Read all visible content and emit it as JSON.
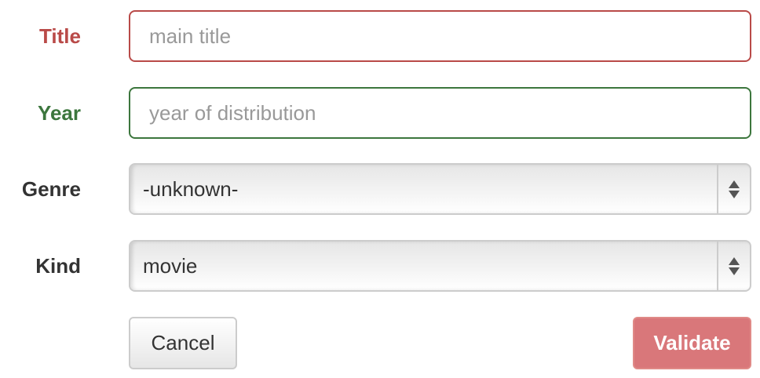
{
  "form": {
    "title": {
      "label": "Title",
      "placeholder": "main title",
      "value": ""
    },
    "year": {
      "label": "Year",
      "placeholder": "year of distribution",
      "value": ""
    },
    "genre": {
      "label": "Genre",
      "selected": "-unknown-"
    },
    "kind": {
      "label": "Kind",
      "selected": "movie"
    }
  },
  "buttons": {
    "cancel": "Cancel",
    "validate": "Validate"
  },
  "colors": {
    "error": "#b94a48",
    "success": "#3c763d",
    "validate_bg": "#d9777a"
  },
  "icons": {
    "select_arrows": "up-down-arrows-icon"
  }
}
